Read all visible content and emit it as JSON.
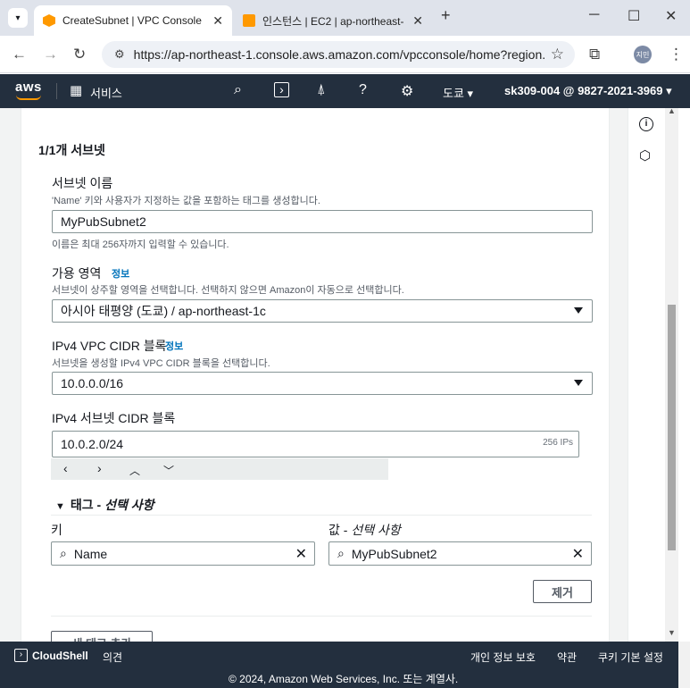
{
  "browser": {
    "tabs": [
      {
        "title": "CreateSubnet | VPC Console",
        "favicon_color": "#ff9900"
      },
      {
        "title": "인스턴스 | EC2 | ap-northeast-",
        "favicon_color": "#ff9900"
      }
    ],
    "url": "https://ap-northeast-1.console.aws.amazon.com/vpcconsole/home?region...",
    "profile_initials": "지민"
  },
  "aws_nav": {
    "logo": "aws",
    "services_label": "서비스",
    "region": "도쿄",
    "account": "sk309-004 @ 9827-2021-3969"
  },
  "subnet": {
    "section_title": "1/1개 서브넷",
    "name_label": "서브넷 이름",
    "name_desc": "'Name' 키와 사용자가 지정하는 값을 포함하는 태그를 생성합니다.",
    "name_value": "MyPubSubnet2",
    "name_hint": "이름은 최대 256자까지 입력할 수 있습니다.",
    "az_label": "가용 영역",
    "info_label": "정보",
    "az_desc": "서브넷이 상주할 영역을 선택합니다. 선택하지 않으면 Amazon이 자동으로 선택합니다.",
    "az_value": "아시아 태평양 (도쿄) / ap-northeast-1c",
    "vpc_cidr_label": "IPv4 VPC CIDR 블록",
    "vpc_cidr_desc": "서브넷을 생성할 IPv4 VPC CIDR 블록을 선택합니다.",
    "vpc_cidr_value": "10.0.0.0/16",
    "subnet_cidr_label": "IPv4 서브넷 CIDR 블록",
    "subnet_cidr_value": "10.0.2.0/24",
    "subnet_cidr_suffix": "256 IPs"
  },
  "tags": {
    "title_main": "태그 - ",
    "title_optional": "선택 사항",
    "key_label": "키",
    "value_label_main": "값 - ",
    "value_label_optional": "선택 사항",
    "key_value": "Name",
    "value_value": "MyPubSubnet2",
    "remove_label": "제거",
    "add_label": "새 태그 추가"
  },
  "footer": {
    "cloudshell": "CloudShell",
    "feedback": "의견",
    "privacy": "개인 정보 보호",
    "terms": "약관",
    "cookies": "쿠키 기본 설정",
    "copyright": "© 2024, Amazon Web Services, Inc. 또는 계열사."
  }
}
